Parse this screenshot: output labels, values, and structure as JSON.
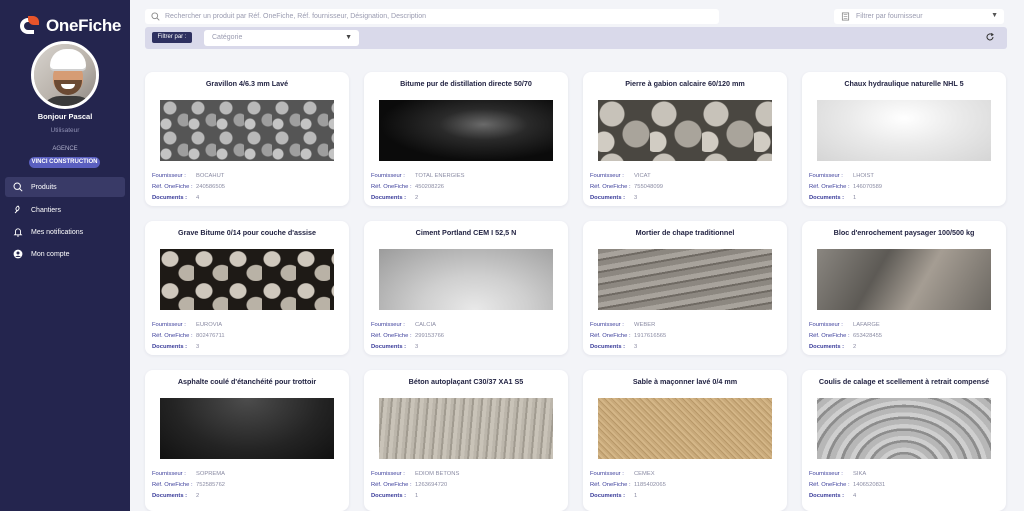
{
  "app": {
    "name": "OneFiche"
  },
  "user": {
    "greeting": "Bonjour Pascal",
    "role": "Utilisateur",
    "agency_label": "AGENCE",
    "agency_name": "VINCI CONSTRUCTION"
  },
  "nav": [
    {
      "label": "Produits",
      "icon": "search-icon",
      "active": true
    },
    {
      "label": "Chantiers",
      "icon": "shovel-icon",
      "active": false
    },
    {
      "label": "Mes notifications",
      "icon": "bell-icon",
      "active": false
    },
    {
      "label": "Mon compte",
      "icon": "user-icon",
      "active": false
    }
  ],
  "search": {
    "placeholder": "Rechercher un produit par Réf. OneFiche, Réf. fournisseur, Désignation, Description"
  },
  "supplier_filter": {
    "placeholder": "Filtrer par fournisseur"
  },
  "filter_bar": {
    "tag": "Filtrer par :",
    "category_placeholder": "Catégorie"
  },
  "meta_labels": {
    "supplier": "Fournisseur :",
    "ref": "Réf. OneFiche :",
    "docs": "Documents :"
  },
  "products": [
    {
      "title": "Gravillon 4/6.3 mm Lavé",
      "supplier": "BOCAHUT",
      "ref": "240586505",
      "documents": "4",
      "texture": "gravel"
    },
    {
      "title": "Bitume pur de distillation directe 50/70",
      "supplier": "TOTAL ENERGIES",
      "ref": "450208226",
      "documents": "2",
      "texture": "bitumen"
    },
    {
      "title": "Pierre à gabion calcaire 60/120 mm",
      "supplier": "VICAT",
      "ref": "755048099",
      "documents": "3",
      "texture": "stones"
    },
    {
      "title": "Chaux hydraulique naturelle NHL 5",
      "supplier": "LHOIST",
      "ref": "146070589",
      "documents": "1",
      "texture": "lime"
    },
    {
      "title": "Grave Bitume 0/14 pour couche d'assise",
      "supplier": "EUROVIA",
      "ref": "802476711",
      "documents": "3",
      "texture": "grave"
    },
    {
      "title": "Ciment Portland CEM I 52,5 N",
      "supplier": "CALCIA",
      "ref": "299153766",
      "documents": "3",
      "texture": "cement"
    },
    {
      "title": "Mortier de chape traditionnel",
      "supplier": "WEBER",
      "ref": "1917616565",
      "documents": "3",
      "texture": "mortar"
    },
    {
      "title": "Bloc d'enrochement paysager 100/500 kg",
      "supplier": "LAFARGE",
      "ref": "653428455",
      "documents": "2",
      "texture": "rock"
    },
    {
      "title": "Asphalte coulé d'étanchéité pour trottoir",
      "supplier": "SOPREMA",
      "ref": "752585762",
      "documents": "2",
      "texture": "asphalt"
    },
    {
      "title": "Béton autoplaçant C30/37 XA1 S5",
      "supplier": "EDIOM BETONS",
      "ref": "1263694720",
      "documents": "1",
      "texture": "concrete"
    },
    {
      "title": "Sable à maçonner lavé 0/4 mm",
      "supplier": "CEMEX",
      "ref": "1185402065",
      "documents": "1",
      "texture": "sand"
    },
    {
      "title": "Coulis de calage et scellement à retrait compensé",
      "supplier": "SIKA",
      "ref": "1406520831",
      "documents": "4",
      "texture": "grout"
    }
  ]
}
